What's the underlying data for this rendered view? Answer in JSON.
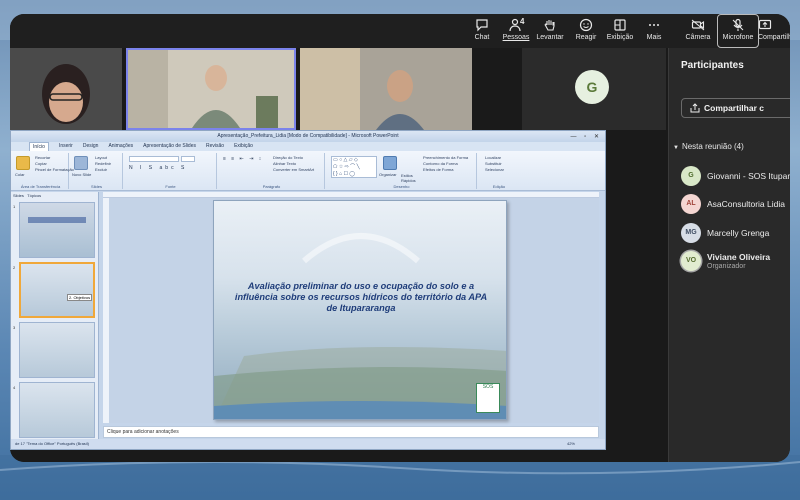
{
  "toolbar": {
    "chat_label": "Chat",
    "people_label": "Pessoas",
    "people_count": "4",
    "raise_label": "Levantar",
    "react_label": "Reagir",
    "view_label": "Exibição",
    "more_label": "Mais",
    "camera_label": "Câmera",
    "mic_label": "Microfone",
    "share_label": "Compartilhar"
  },
  "video": {
    "avatar_letter": "G"
  },
  "ppt": {
    "window_title": "Apresentação_Prefeitura_Lidia [Modo de Compatibilidade] - Microsoft PowerPoint",
    "tabs": [
      "Início",
      "Inserir",
      "Design",
      "Animações",
      "Apresentação de Slides",
      "Revisão",
      "Exibição"
    ],
    "ribbon": {
      "clipboard_group": "Área de Transferência",
      "clipboard_items": [
        "Recortar",
        "Copiar",
        "Pincel de Formatação"
      ],
      "paste_label": "Colar",
      "slides_group": "Slides",
      "slides_items": [
        "Layout",
        "Redefinir",
        "Excluir"
      ],
      "new_slide_label": "Novo Slide",
      "font_group": "Fonte",
      "paragraph_group": "Parágrafo",
      "paragraph_items": [
        "Direção do Texto",
        "Alinhar Texto",
        "Converter em SmartArt"
      ],
      "drawing_group": "Desenho",
      "arrange_label": "Organizar",
      "quick_styles_label": "Estilos Rápidos",
      "drawing_items": [
        "Preenchimento da Forma",
        "Contorno da Forma",
        "Efeitos de Forma"
      ],
      "editing_group": "Edição",
      "editing_items": [
        "Localizar",
        "Substituir",
        "Selecionar"
      ]
    },
    "thumb_tabs": [
      "Slides",
      "Tópicos"
    ],
    "thumb_numbers": [
      "1",
      "2",
      "3",
      "4"
    ],
    "thumb_callout": "2. Objetivos",
    "slide_title": "Avaliação preliminar do uso e ocupação do solo e a influência sobre os recursos hídricos do território da APA de Itupararanga",
    "slide_logo_text": "SOS",
    "notes_placeholder": "Clique para adicionar anotações",
    "status_left": "de 17   \"Tema do Office\"   Português (Brasil)",
    "status_zoom": "42%"
  },
  "panel": {
    "title": "Participantes",
    "share_button": "Compartilhar c",
    "section": "Nesta reunião (4)",
    "people": [
      {
        "initials": "G",
        "name": "Giovanni - SOS Itupara",
        "role": "",
        "bg": "#d9e8c8",
        "fg": "#4e6b2c"
      },
      {
        "initials": "AL",
        "name": "AsaConsultoria Lidia",
        "role": "",
        "bg": "#f4d6d2",
        "fg": "#a0443a"
      },
      {
        "initials": "MG",
        "name": "Marcelly Grenga",
        "role": "",
        "bg": "#d7dde6",
        "fg": "#3f4d63"
      },
      {
        "initials": "VO",
        "name": "Viviane Oliveira",
        "role": "Organizador",
        "bg": "#e2ecd0",
        "fg": "#556b2f"
      }
    ]
  }
}
